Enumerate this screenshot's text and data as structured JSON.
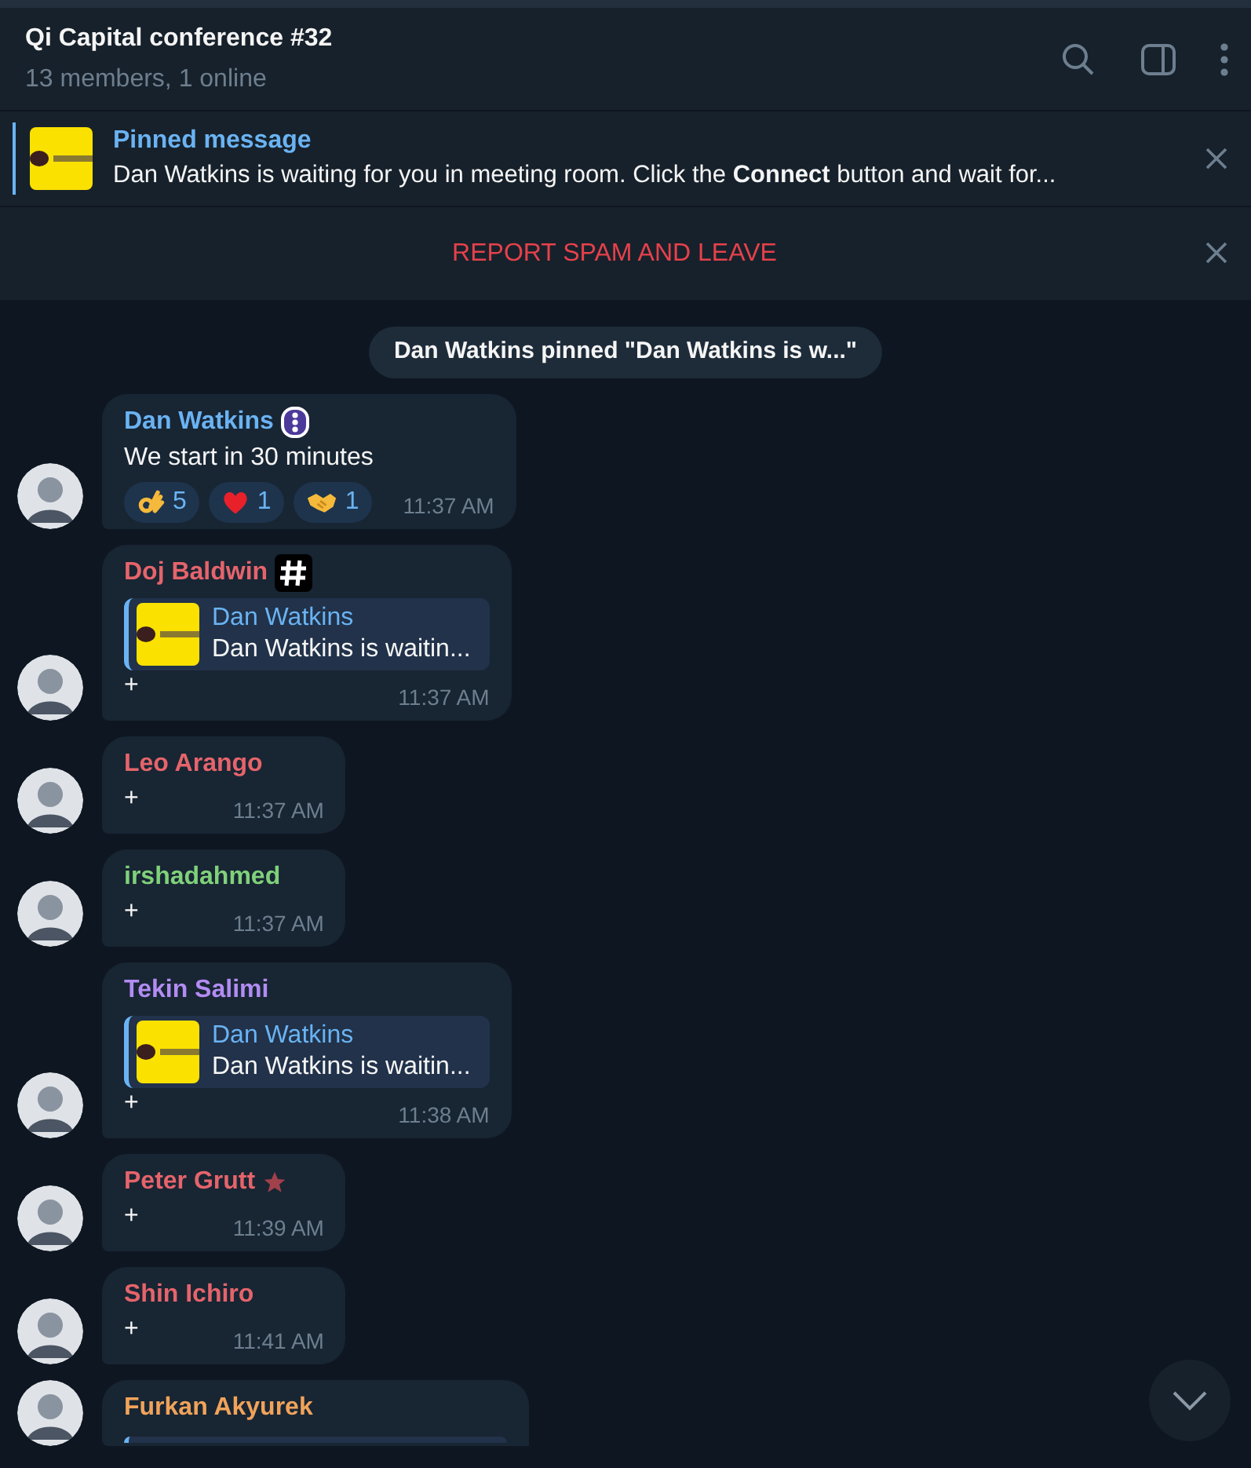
{
  "header": {
    "title": "Qi Capital conference #32",
    "subtitle": "13 members, 1 online"
  },
  "pinned": {
    "label": "Pinned message",
    "text": "Dan Watkins is waiting for you in meeting room. Click the **Connect** button and wait for..."
  },
  "spam_bar": {
    "label": "REPORT SPAM AND LEAVE"
  },
  "service_message": "Dan Watkins pinned \"Dan Watkins is w...\"",
  "messages": [
    {
      "kind": "text",
      "author": "Dan Watkins",
      "color": "#6ab3f3",
      "badge": {
        "kind": "dots"
      },
      "text": "We start in 30 minutes",
      "reactions": [
        {
          "kind": "ok",
          "count": "5"
        },
        {
          "kind": "heart",
          "count": "1"
        },
        {
          "kind": "handshake",
          "count": "1"
        }
      ],
      "time": "11:37 AM"
    },
    {
      "kind": "reply",
      "author": "Doj Baldwin",
      "color": "#e5646b",
      "badge": {
        "kind": "hash"
      },
      "reply": {
        "author": "Dan Watkins",
        "text": "Dan Watkins is waitin..."
      },
      "text": "+",
      "time": "11:37 AM"
    },
    {
      "kind": "text",
      "author": "Leo Arango",
      "color": "#e5646b",
      "text": "+",
      "time": "11:37 AM"
    },
    {
      "kind": "text",
      "author": "irshadahmed",
      "color": "#7fd17a",
      "text": "+",
      "time": "11:37 AM"
    },
    {
      "kind": "reply",
      "author": "Tekin Salimi",
      "color": "#b28cf3",
      "reply": {
        "author": "Dan Watkins",
        "text": "Dan Watkins is waitin..."
      },
      "text": "+",
      "time": "11:38 AM"
    },
    {
      "kind": "text",
      "author": "Peter Grutt",
      "color": "#e5646b",
      "badge": {
        "kind": "star"
      },
      "text": "+",
      "time": "11:39 AM"
    },
    {
      "kind": "text",
      "author": "Shin Ichiro",
      "color": "#e5646b",
      "text": "+",
      "time": "11:41 AM"
    },
    {
      "kind": "partial",
      "author": "Furkan Akyurek",
      "color": "#f0a35a"
    }
  ]
}
